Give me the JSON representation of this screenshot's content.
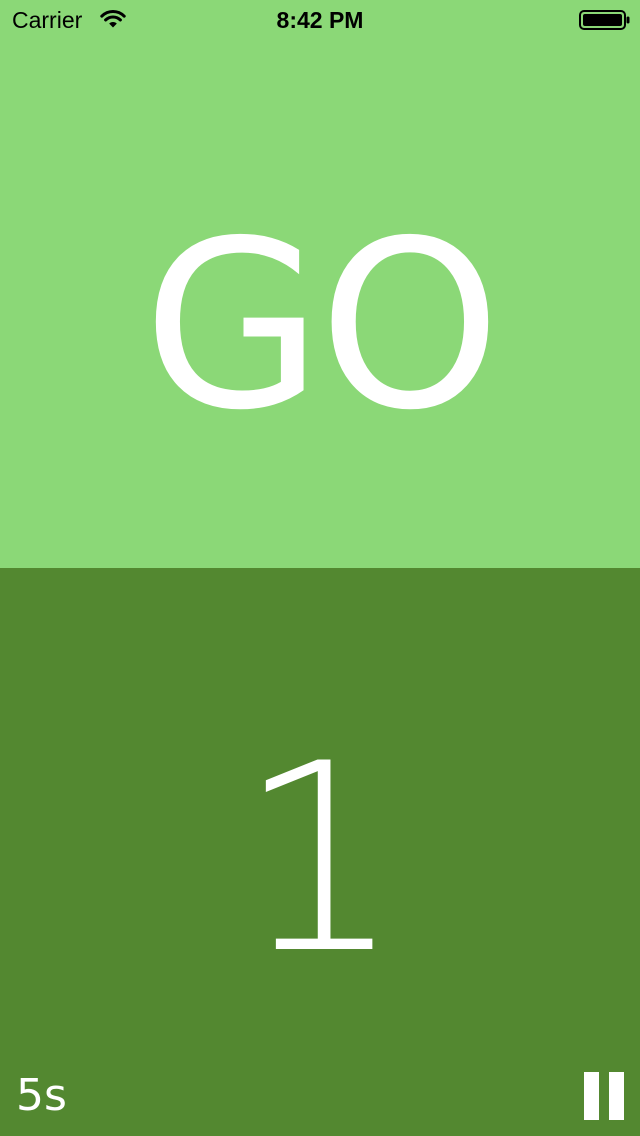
{
  "status_bar": {
    "carrier": "Carrier",
    "time": "8:42 PM",
    "wifi_icon": "wifi-icon",
    "battery_icon": "battery-full-icon"
  },
  "timer": {
    "phase": "GO",
    "count": "1",
    "interval": "5s",
    "pause_icon": "pause-icon"
  },
  "colors": {
    "top_background": "#8bd877",
    "bottom_background": "#538830",
    "text": "#ffffff"
  }
}
